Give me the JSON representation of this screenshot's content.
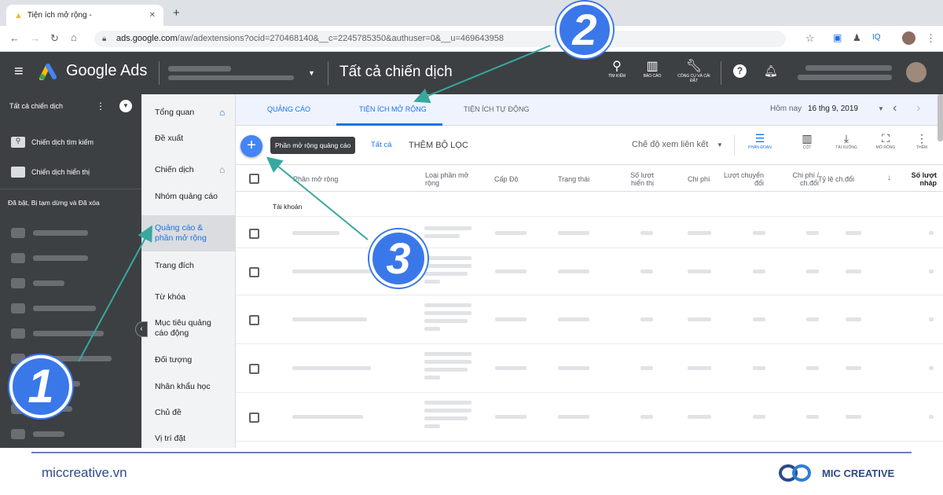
{
  "browser": {
    "tab_title": "Tiện ích mở rộng -",
    "url_domain": "ads.google.com",
    "url_path": "/aw/adextensions?ocid=270468140&__c=2245785350&authuser=0&__u=469643958"
  },
  "header": {
    "product": "Google Ads",
    "campaign_title": "Tất cả chiến dịch",
    "icons": [
      {
        "label": "TÌM KIẾM",
        "icon": "search-icon"
      },
      {
        "label": "BÁO CÁO",
        "icon": "report-icon"
      },
      {
        "label": "CÔNG CỤ VÀ CÀI ĐẶT",
        "icon": "wrench-icon"
      }
    ]
  },
  "sidebar": {
    "header": "Tất cả chiến dịch",
    "items": [
      {
        "label": "Chiến dịch tìm kiếm",
        "icon": "search-campaign-icon"
      },
      {
        "label": "Chiến dịch hiển thị",
        "icon": "display-campaign-icon"
      }
    ],
    "filter_label": "Đã bật, Bị tạm dừng và Đã xóa"
  },
  "nav": {
    "items": [
      {
        "label": "Tổng quan"
      },
      {
        "label": "Đề xuất"
      },
      {
        "label": "Chiến dịch"
      },
      {
        "label": "Nhóm quảng cáo"
      },
      {
        "label": "Quảng cáo & phần mở rộng",
        "active": true
      },
      {
        "label": "Trang đích"
      },
      {
        "label": "Từ khóa"
      },
      {
        "label": "Mục tiêu quảng cáo động"
      },
      {
        "label": "Đối tượng"
      },
      {
        "label": "Nhân khẩu học"
      },
      {
        "label": "Chủ đề"
      },
      {
        "label": "Vị trí đặt"
      }
    ]
  },
  "main": {
    "tabs": [
      "QUẢNG CÁO",
      "TIỆN ÍCH MỞ RỘNG",
      "TIỆN ÍCH TỰ ĐỘNG"
    ],
    "date_prefix": "Hôm nay",
    "date": "16 thg 9, 2019",
    "tooltip": "Phần mở rộng quảng cáo",
    "filter_all": "Tất cả",
    "add_filter": "THÊM BỘ LỌC",
    "view_mode": "Chế độ xem liên kết",
    "tools": [
      "PHÂN ĐOẠN",
      "CỘT",
      "TẢI XUỐNG",
      "MỞ RỘNG",
      "THÊM"
    ],
    "columns": [
      "Phần mở rộng",
      "Loại phần mở rộng",
      "Cấp Độ",
      "Trạng thái",
      "Số lượt hiển thị",
      "Chi phí",
      "Lượt chuyển đổi",
      "Chi phí / ch.đổi",
      "Tỷ lệ ch.đổi",
      "Số lượt nháp"
    ],
    "group_label": "Tài khoản"
  },
  "annotations": [
    "1",
    "2",
    "3"
  ],
  "footer": {
    "website": "miccreative.vn",
    "brand": "MIC CREATIVE"
  },
  "colors": {
    "header_bg": "#3c4043",
    "accent_blue": "#1a73e8",
    "annotation_blue": "#3a78ea",
    "arrow_teal": "#37a89e"
  }
}
